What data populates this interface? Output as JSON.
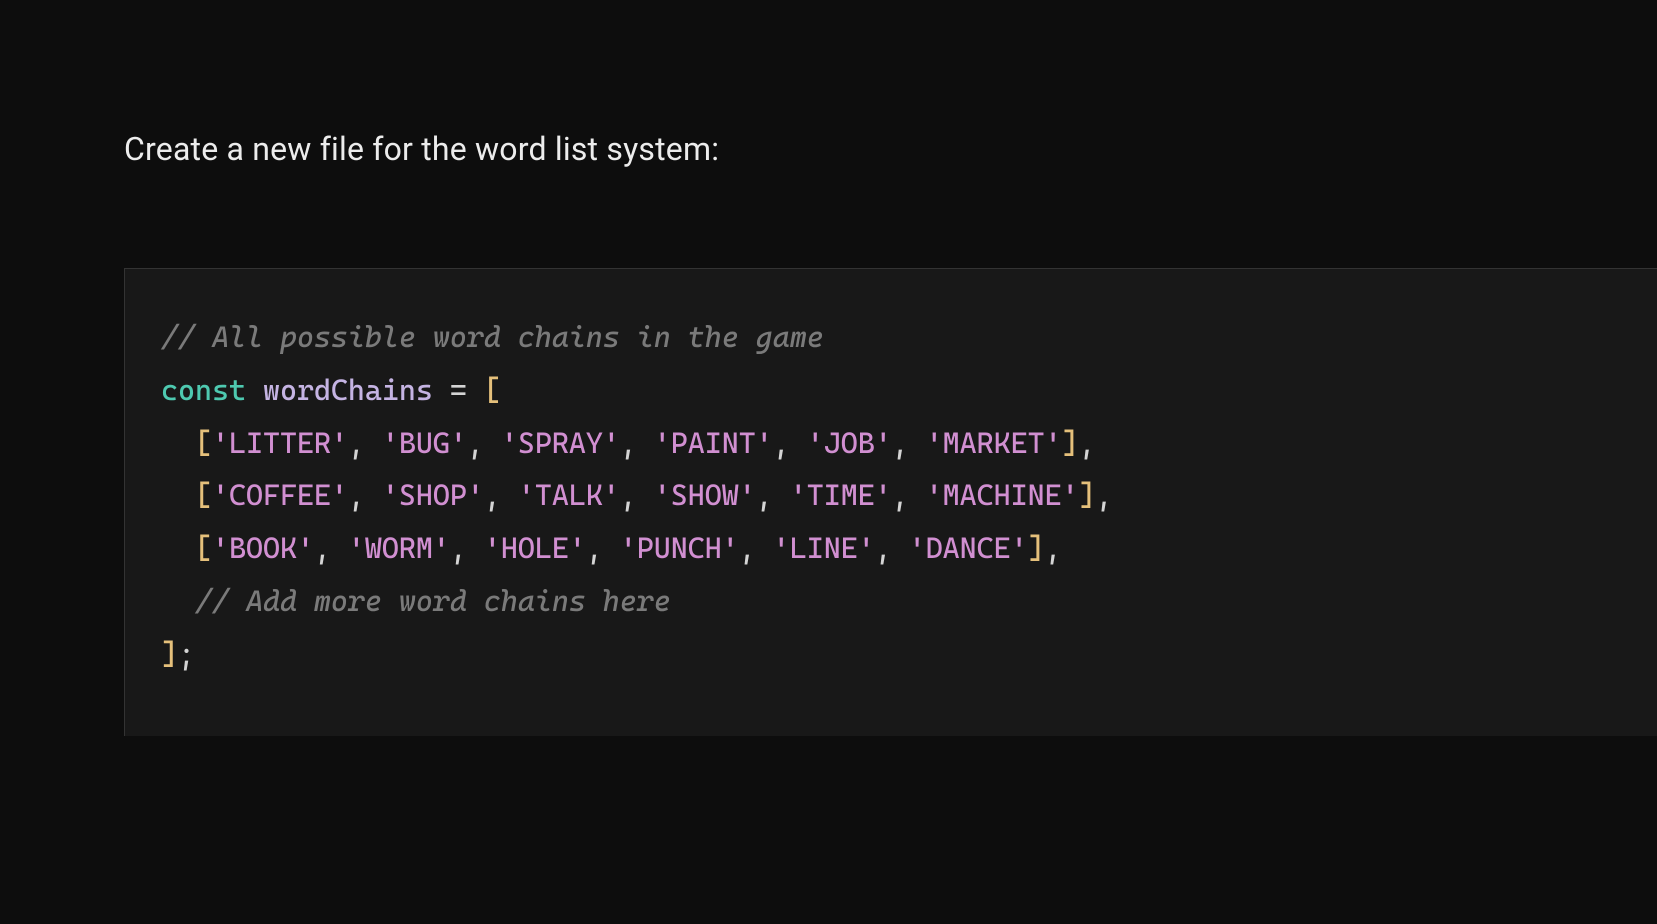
{
  "instruction": "Create a new file for the word list system:",
  "code": {
    "comment_top": "// All possible word chains in the game",
    "keyword_const": "const",
    "ident_name": "wordChains",
    "eq": " = ",
    "open_bracket": "[",
    "rows": [
      [
        "'LITTER'",
        "'BUG'",
        "'SPRAY'",
        "'PAINT'",
        "'JOB'",
        "'MARKET'"
      ],
      [
        "'COFFEE'",
        "'SHOP'",
        "'TALK'",
        "'SHOW'",
        "'TIME'",
        "'MACHINE'"
      ],
      [
        "'BOOK'",
        "'WORM'",
        "'HOLE'",
        "'PUNCH'",
        "'LINE'",
        "'DANCE'"
      ]
    ],
    "comment_more": "// Add more word chains here",
    "close": "];"
  }
}
